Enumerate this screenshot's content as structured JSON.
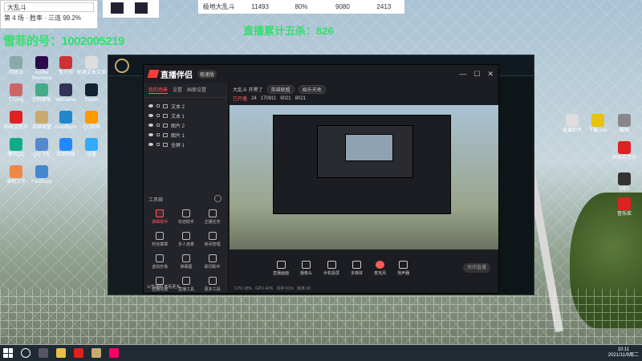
{
  "overlay": {
    "game_label": "大乱斗",
    "info_line": "第 4 场 · 胜率 · 三连 99.2%",
    "stats": [
      "极地大乱斗",
      "11493",
      "80%",
      "9080",
      "2413"
    ]
  },
  "overlay_text": {
    "qq_number": "雪菲的号：1002005219",
    "streak": "直播累计五杀：826"
  },
  "desktop_icons_left": [
    {
      "label": "回收站",
      "color": "#8aa"
    },
    {
      "label": "Adobe Premiere",
      "color": "#2a0a4a"
    },
    {
      "label": "鲁大师",
      "color": "#c33"
    },
    {
      "label": "新建文本文档",
      "color": "#ddd"
    },
    {
      "label": "TT.png",
      "color": "#c66"
    },
    {
      "label": "控制面板",
      "color": "#4a8"
    },
    {
      "label": "WeGame",
      "color": "#335"
    },
    {
      "label": "Steam",
      "color": "#123"
    },
    {
      "label": "网易云音乐",
      "color": "#d22"
    },
    {
      "label": "英雄联盟",
      "color": "#c8aa6e"
    },
    {
      "label": "GoodSync",
      "color": "#28c"
    },
    {
      "label": "QQ游戏",
      "color": "#f90"
    },
    {
      "label": "腾讯QQ",
      "color": "#1a8"
    },
    {
      "label": "QQ飞车",
      "color": "#58c"
    },
    {
      "label": "百度网盘",
      "color": "#28f"
    },
    {
      "label": "迅雷",
      "color": "#3af"
    },
    {
      "label": "录制文件",
      "color": "#e84"
    },
    {
      "label": "FastCopy",
      "color": "#48c"
    }
  ],
  "desktop_icons_right": [
    {
      "label": "直播助手",
      "color": "#ddd"
    },
    {
      "label": "下载.exe",
      "color": "#e9c200"
    },
    {
      "label": "截图",
      "color": "#888"
    },
    {
      "label": "网易云音乐",
      "color": "#d22"
    },
    {
      "label": "OBS",
      "color": "#333"
    },
    {
      "label": "音乐库",
      "color": "#d22"
    }
  ],
  "app": {
    "brand": "直播伴侣",
    "version": "极速版",
    "tabs": [
      "我的场景",
      "设置",
      "画面设置"
    ],
    "active_tab_index": 0,
    "scenes": [
      "文本 2",
      "文本 1",
      "图片 2",
      "图片 1",
      "全屏 1"
    ],
    "tools_title": "工具箱",
    "tools": [
      {
        "label": "弹幕助手",
        "red": true
      },
      {
        "label": "欢迎助手",
        "red": false
      },
      {
        "label": "主播任务",
        "red": false
      },
      {
        "label": "粉丝徽章",
        "red": false
      },
      {
        "label": "多人连麦",
        "red": false
      },
      {
        "label": "房间管理",
        "red": false
      },
      {
        "label": "虚拟形象",
        "red": false
      },
      {
        "label": "弹幕图",
        "red": false
      },
      {
        "label": "歌词助手",
        "red": false
      },
      {
        "label": "直播设置",
        "red": false
      },
      {
        "label": "直播工具",
        "red": false
      },
      {
        "label": "更多工具",
        "red": false
      }
    ],
    "notice": "公告通知 查看更多",
    "room_title": "大乱斗 开黑了",
    "room_category": "英雄联盟",
    "room_tag": "娱乐天地",
    "room_row2": [
      "直播状态",
      "主播等级",
      "弹幕数量",
      "礼物数",
      "粉丝"
    ],
    "room_row2_values": [
      "已开播",
      "24",
      "170911",
      "9021",
      "8021"
    ],
    "bottom_buttons": [
      {
        "label": "直播画面",
        "mic": false
      },
      {
        "label": "摄像头",
        "mic": false
      },
      {
        "label": "手机投屏",
        "mic": false
      },
      {
        "label": "多媒体",
        "mic": false
      },
      {
        "label": "麦克风",
        "mic": true
      },
      {
        "label": "扬声器",
        "mic": false
      }
    ],
    "start_label": "关闭直播",
    "status_items": [
      "CPU 18%",
      "GPU 42%",
      "内存 61%",
      "帧率 60"
    ]
  },
  "taskbar": {
    "time": "10:11",
    "date": "2021/11/9周二"
  }
}
